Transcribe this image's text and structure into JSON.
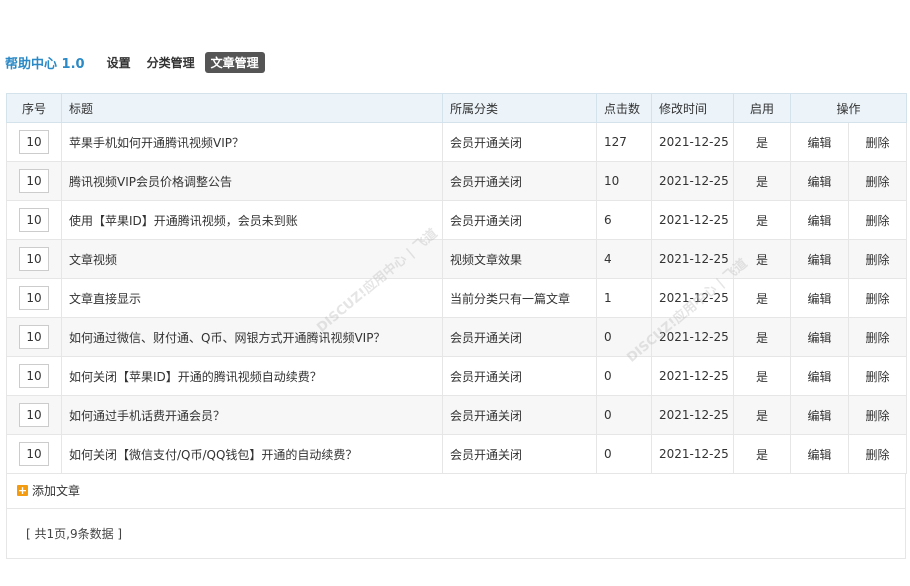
{
  "header": {
    "app_title": "帮助中心 1.0",
    "nav": [
      {
        "label": "设置",
        "active": false
      },
      {
        "label": "分类管理",
        "active": false
      },
      {
        "label": "文章管理",
        "active": true
      }
    ]
  },
  "table": {
    "columns": [
      "序号",
      "标题",
      "所属分类",
      "点击数",
      "修改时间",
      "启用",
      "操作"
    ],
    "rows": [
      {
        "seq": "10",
        "title": "苹果手机如何开通腾讯视频VIP？",
        "category": "会员开通关闭",
        "clicks": "127",
        "date": "2021-12-25",
        "enabled": "是",
        "edit": "编辑",
        "delete": "删除"
      },
      {
        "seq": "10",
        "title": "腾讯视频VIP会员价格调整公告",
        "category": "会员开通关闭",
        "clicks": "10",
        "date": "2021-12-25",
        "enabled": "是",
        "edit": "编辑",
        "delete": "删除"
      },
      {
        "seq": "10",
        "title": "使用【苹果ID】开通腾讯视频，会员未到账",
        "category": "会员开通关闭",
        "clicks": "6",
        "date": "2021-12-25",
        "enabled": "是",
        "edit": "编辑",
        "delete": "删除"
      },
      {
        "seq": "10",
        "title": "文章视频",
        "category": "视频文章效果",
        "clicks": "4",
        "date": "2021-12-25",
        "enabled": "是",
        "edit": "编辑",
        "delete": "删除"
      },
      {
        "seq": "10",
        "title": "文章直接显示",
        "category": "当前分类只有一篇文章",
        "clicks": "1",
        "date": "2021-12-25",
        "enabled": "是",
        "edit": "编辑",
        "delete": "删除"
      },
      {
        "seq": "10",
        "title": "如何通过微信、财付通、Q币、网银方式开通腾讯视频VIP？",
        "category": "会员开通关闭",
        "clicks": "0",
        "date": "2021-12-25",
        "enabled": "是",
        "edit": "编辑",
        "delete": "删除"
      },
      {
        "seq": "10",
        "title": "如何关闭【苹果ID】开通的腾讯视频自动续费？",
        "category": "会员开通关闭",
        "clicks": "0",
        "date": "2021-12-25",
        "enabled": "是",
        "edit": "编辑",
        "delete": "删除"
      },
      {
        "seq": "10",
        "title": "如何通过手机话费开通会员？",
        "category": "会员开通关闭",
        "clicks": "0",
        "date": "2021-12-25",
        "enabled": "是",
        "edit": "编辑",
        "delete": "删除"
      },
      {
        "seq": "10",
        "title": "如何关闭【微信支付/Q币/QQ钱包】开通的自动续费？",
        "category": "会员开通关闭",
        "clicks": "0",
        "date": "2021-12-25",
        "enabled": "是",
        "edit": "编辑",
        "delete": "删除"
      }
    ]
  },
  "add": {
    "icon": "plus-icon",
    "label": "添加文章"
  },
  "pager": {
    "text": "[ 共1页,9条数据 ]"
  },
  "watermark": {
    "text": "DISCUZ!应用中心 | 飞道"
  },
  "colors": {
    "accent": "#2b8ac6",
    "enabled": "#009900",
    "edit": "#2266bb",
    "delete": "#cc3333"
  }
}
